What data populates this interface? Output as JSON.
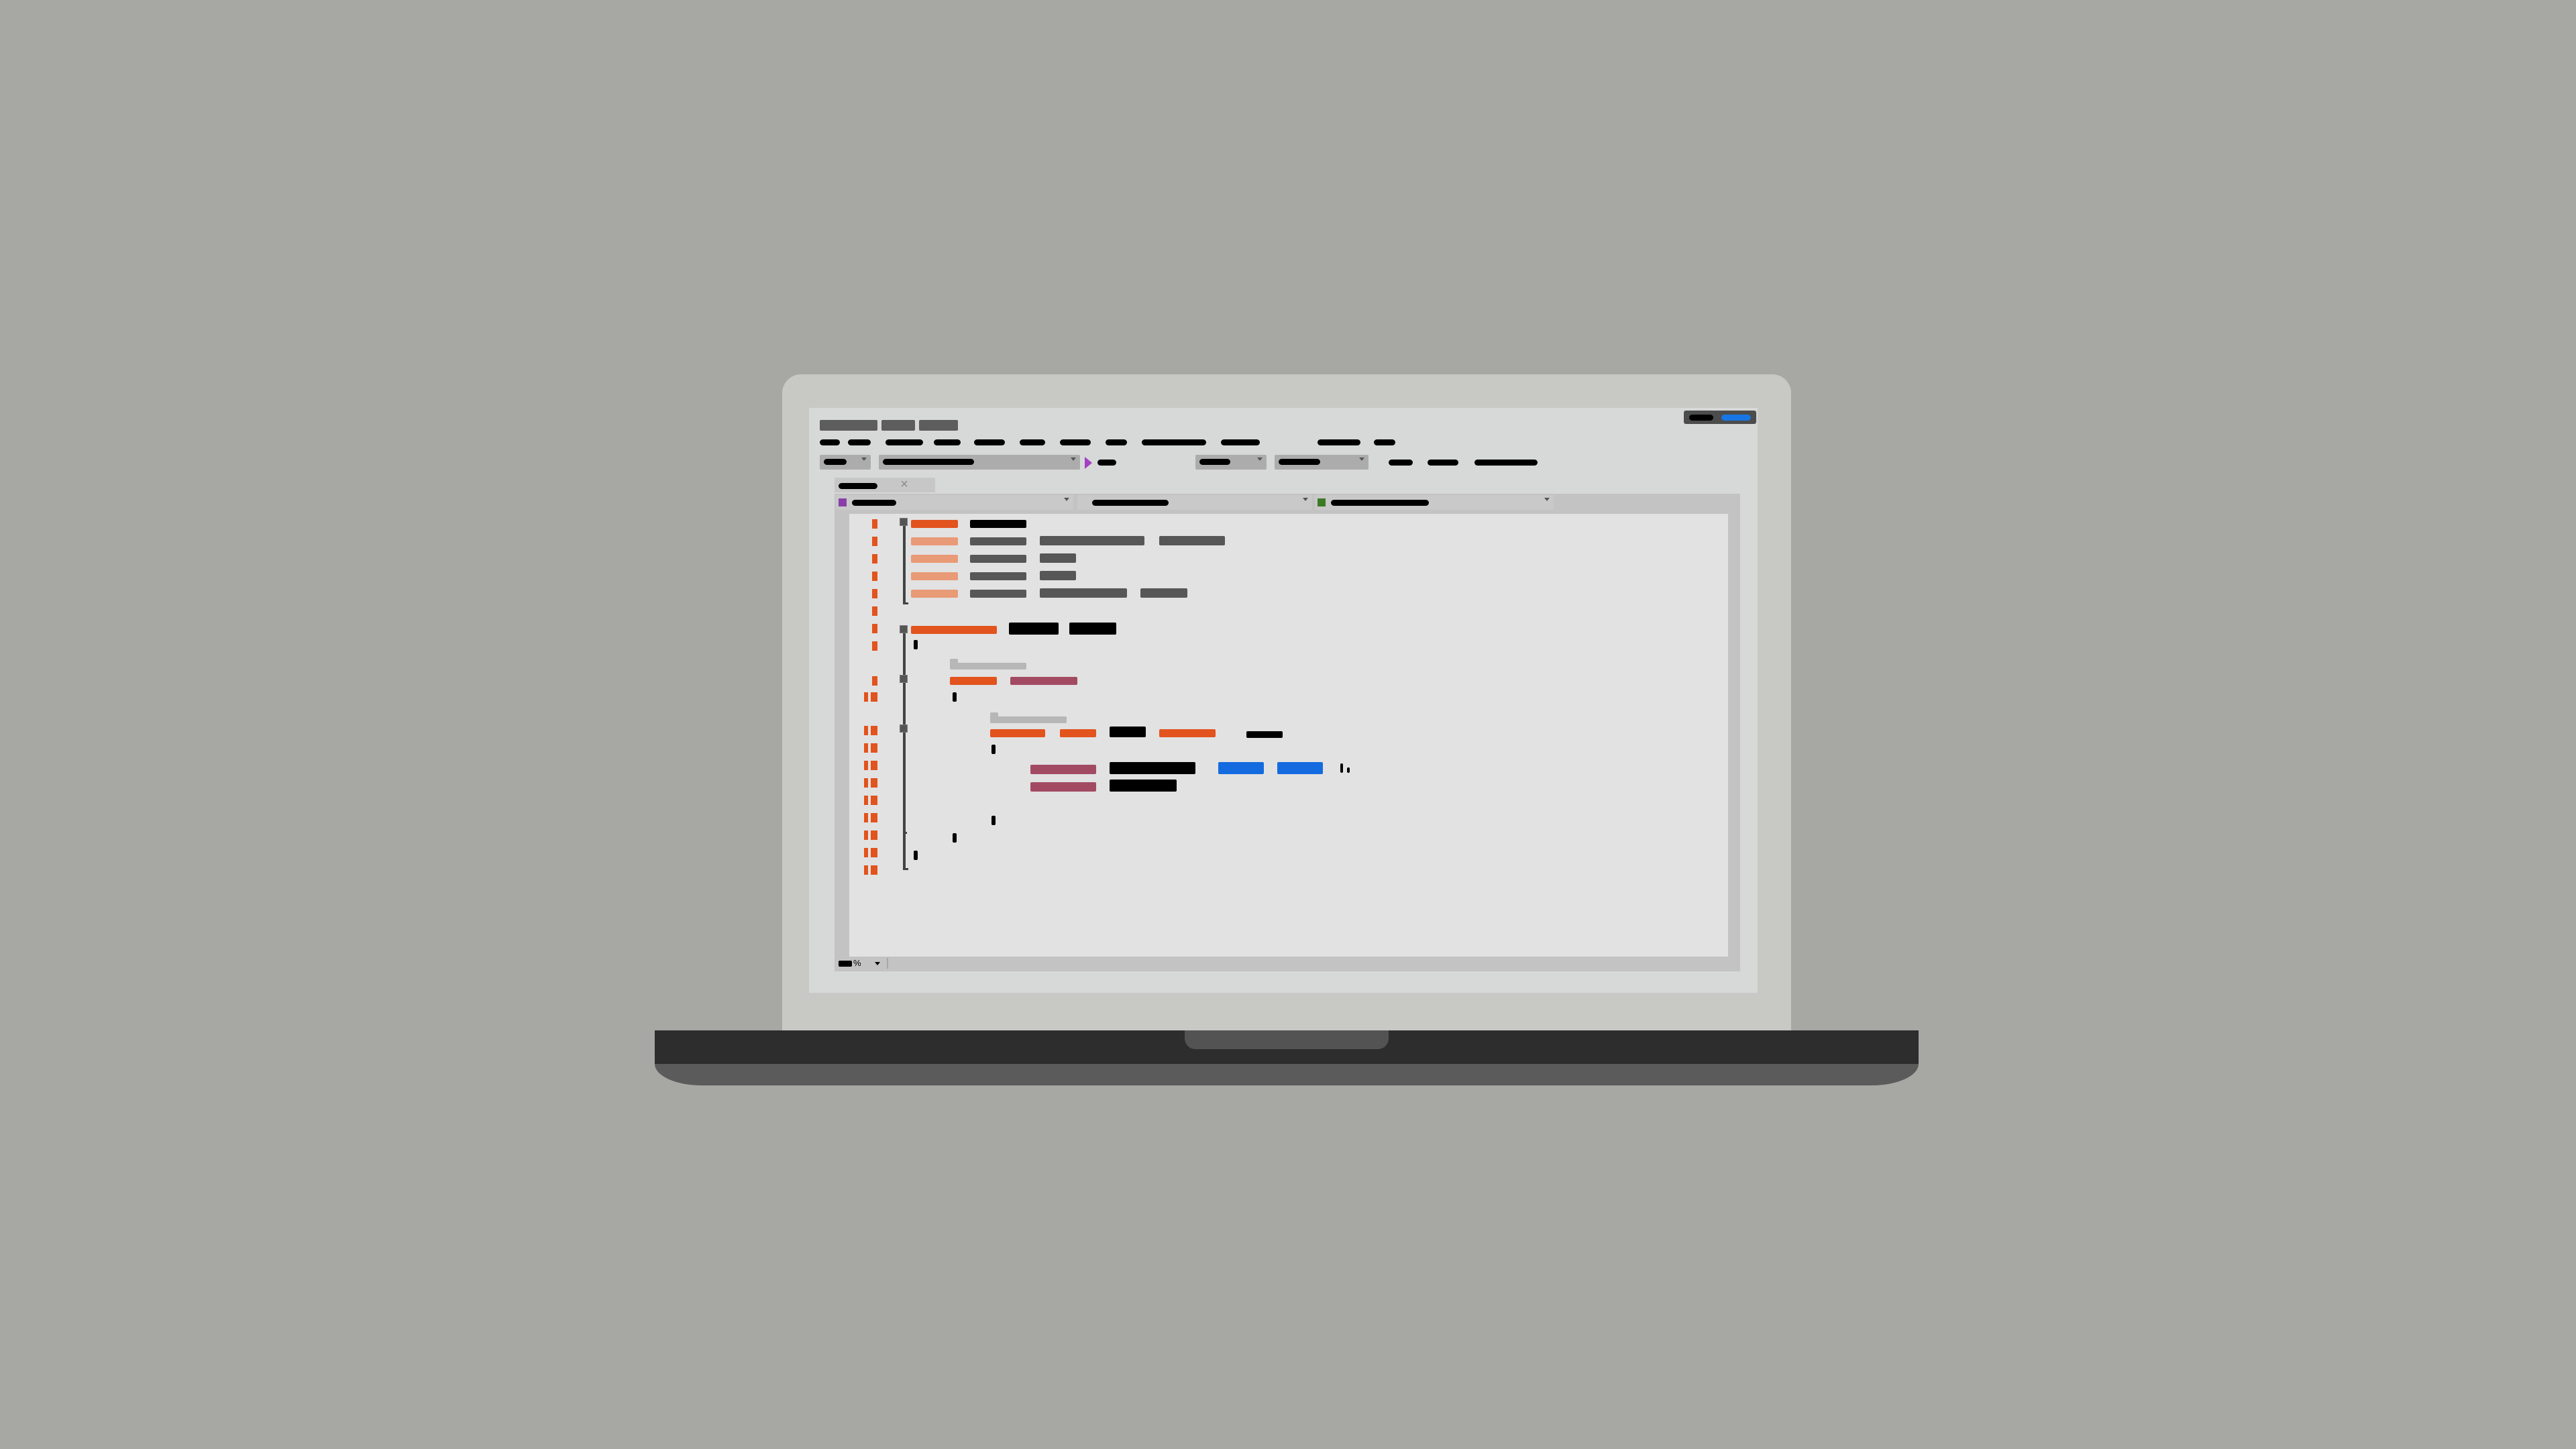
{
  "window": {
    "menu_items": [
      "",
      "",
      "",
      "",
      "",
      "",
      "",
      "",
      "",
      "",
      "",
      "",
      "",
      "",
      ""
    ],
    "toolbar_items": [
      "",
      "",
      "",
      "",
      "",
      "",
      "",
      "",
      ""
    ]
  },
  "editor": {
    "tab_label": "",
    "navigation_bar": [
      "",
      "",
      ""
    ],
    "status": {
      "zoom": ""
    }
  },
  "colors": {
    "background": "#a7a8a3",
    "accent_orange": "#e2531d",
    "light_orange": "#e99a76",
    "magenta": "#a34a63",
    "blue": "#146be0",
    "dark_text": "#000000",
    "gray_text": "#575757"
  },
  "icons": {
    "play": "play-icon",
    "close_tab": "close-icon",
    "project": "project-icon",
    "member": "member-icon"
  }
}
